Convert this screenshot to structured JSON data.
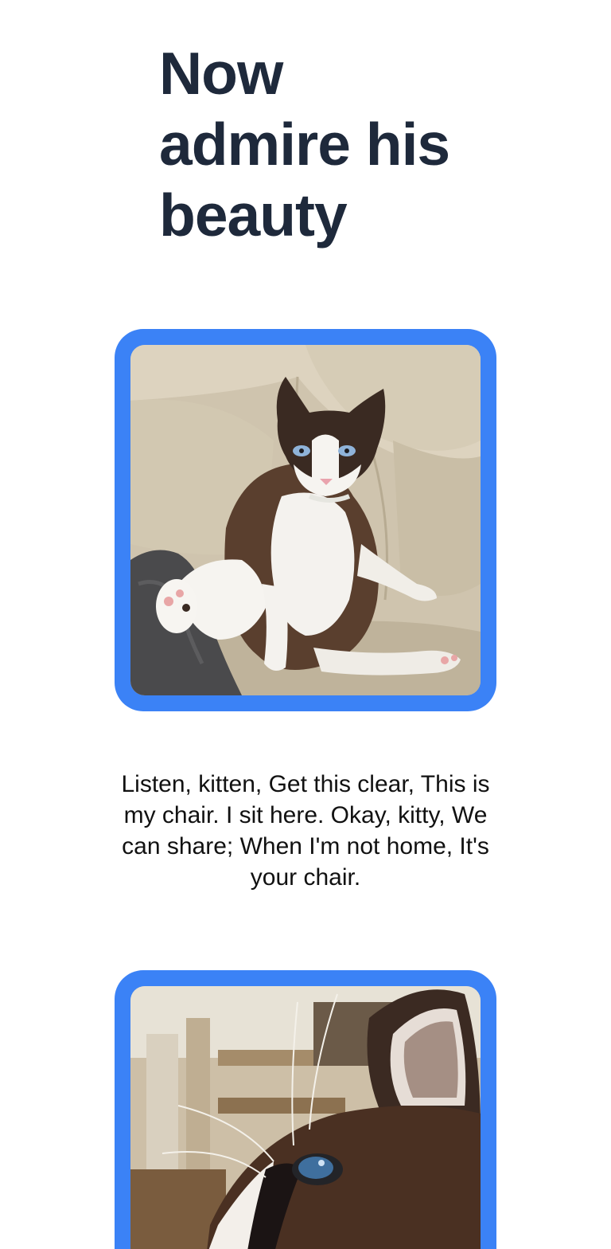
{
  "section": {
    "title_lines": [
      "Now",
      "admire his",
      "beauty"
    ]
  },
  "gallery": [
    {
      "subject": "snowshoe cat sitting on a beige sofa",
      "caption": "Listen, kitten, Get this clear, This is my chair. I sit here. Okay, kitty, We can share; When I'm not home, It's your chair."
    },
    {
      "subject": "close-up of cat face with blue eye"
    }
  ],
  "colors": {
    "frame": "#3b82f6",
    "title": "#1e293b",
    "text": "#111111",
    "background": "#ffffff"
  }
}
